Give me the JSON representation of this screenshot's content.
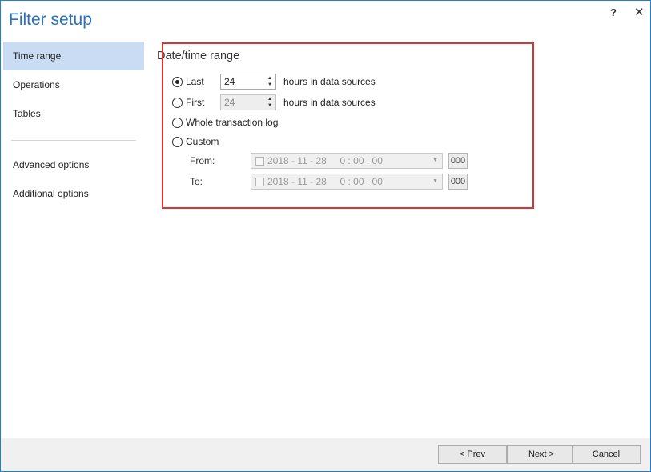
{
  "window": {
    "title": "Filter setup",
    "help_label": "?",
    "close_label": "✕"
  },
  "sidebar": {
    "items": [
      {
        "label": "Time range",
        "active": true
      },
      {
        "label": "Operations"
      },
      {
        "label": "Tables"
      },
      {
        "label": "Advanced options"
      },
      {
        "label": "Additional options"
      }
    ]
  },
  "section": {
    "title": "Date/time range"
  },
  "options": {
    "last": {
      "label": "Last",
      "value": "24",
      "unit": "hours in data sources",
      "checked": true
    },
    "first": {
      "label": "First",
      "value": "24",
      "unit": "hours in data sources",
      "checked": false
    },
    "whole": {
      "label": "Whole transaction log",
      "checked": false
    },
    "custom": {
      "label": "Custom",
      "checked": false
    }
  },
  "custom_range": {
    "from": {
      "label": "From:",
      "value": "2018 - 11 - 28     0 : 00 : 00",
      "ms": "000"
    },
    "to": {
      "label": "To:",
      "value": "2018 - 11 - 28     0 : 00 : 00",
      "ms": "000"
    }
  },
  "buttons": {
    "prev": "< Prev",
    "next": "Next >",
    "cancel": "Cancel"
  },
  "colors": {
    "accent": "#2a72b8",
    "highlight_border": "#e03030",
    "active_nav": "#c9dcf3"
  }
}
